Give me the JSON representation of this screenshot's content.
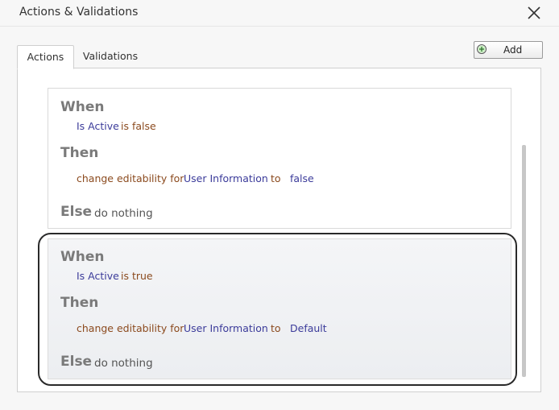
{
  "window": {
    "title": "Actions & Validations"
  },
  "tabs": [
    {
      "label": "Actions",
      "active": true
    },
    {
      "label": "Validations",
      "active": false
    }
  ],
  "toolbar": {
    "add_label": "Add",
    "add_icon": "plus-circle-icon"
  },
  "rules": [
    {
      "when_kw": "When",
      "condition_field": "Is Active",
      "condition_op": "is false",
      "then_kw": "Then",
      "action_text": "change editability for",
      "action_target": "User Information",
      "action_to": "to",
      "action_value": "false",
      "else_kw": "Else",
      "else_text": "do nothing"
    },
    {
      "when_kw": "When",
      "condition_field": "Is Active",
      "condition_op": "is true",
      "then_kw": "Then",
      "action_text": "change editability for",
      "action_target": "User Information",
      "action_to": "to",
      "action_value": "Default",
      "else_kw": "Else",
      "else_text": "do nothing"
    }
  ]
}
